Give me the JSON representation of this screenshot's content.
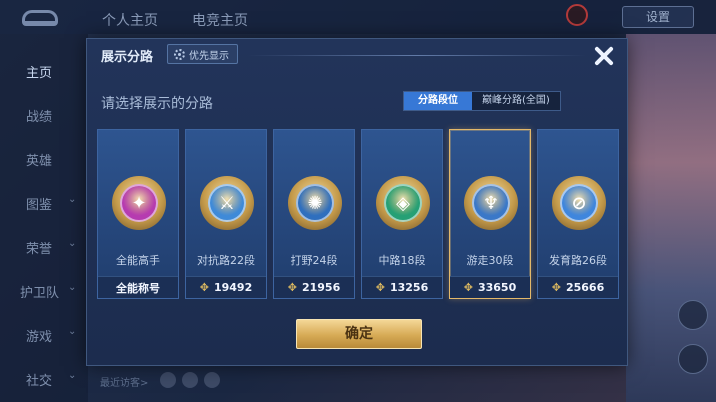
{
  "background": {
    "tabs": [
      "个人主页",
      "电竞主页"
    ],
    "settings_label": "设置",
    "sidebar": [
      {
        "label": "主页"
      },
      {
        "label": "战绩"
      },
      {
        "label": "英雄"
      },
      {
        "label": "图鉴",
        "arrow": "⌄"
      },
      {
        "label": "荣誉",
        "arrow": "⌄"
      },
      {
        "label": "护卫队",
        "arrow": "⌄"
      },
      {
        "label": "游戏",
        "arrow": "⌄"
      },
      {
        "label": "社交",
        "arrow": "⌄"
      }
    ],
    "footer_text": "最近访客>"
  },
  "modal": {
    "title": "展示分路",
    "priority_label": "优先显示",
    "prompt": "请选择展示的分路",
    "toggle": [
      "分路段位",
      "巅峰分路(全国)"
    ],
    "cards": [
      {
        "name": "全能高手",
        "footer": "全能称号",
        "score": "",
        "emblem": "✦",
        "color": "#b63bb0",
        "selected": false
      },
      {
        "name": "对抗路22段",
        "footer": "",
        "score": "19492",
        "emblem": "⚔",
        "color": "#3f8ad8",
        "selected": false
      },
      {
        "name": "打野24段",
        "footer": "",
        "score": "21956",
        "emblem": "✺",
        "color": "#2f6fbe",
        "selected": false
      },
      {
        "name": "中路18段",
        "footer": "",
        "score": "13256",
        "emblem": "◈",
        "color": "#25a075",
        "selected": false
      },
      {
        "name": "游走30段",
        "footer": "",
        "score": "33650",
        "emblem": "♆",
        "color": "#3a78c8",
        "selected": true
      },
      {
        "name": "发育路26段",
        "footer": "",
        "score": "25666",
        "emblem": "⊘",
        "color": "#3f86dd",
        "selected": false
      }
    ],
    "score_icon": "✥",
    "confirm_label": "确定"
  }
}
